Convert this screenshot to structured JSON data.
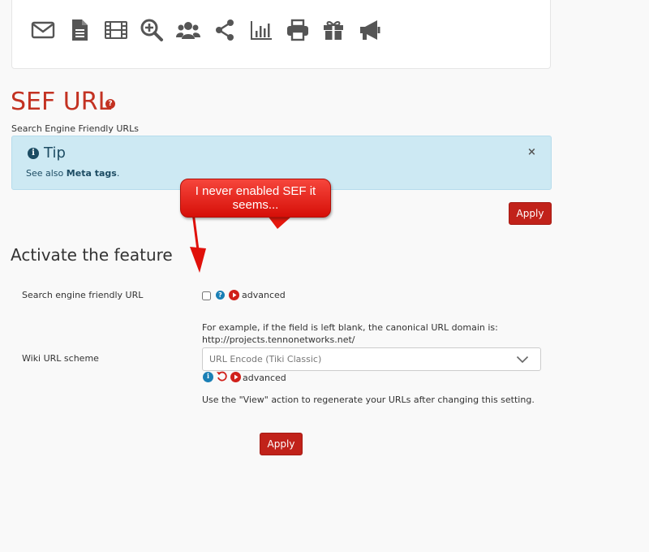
{
  "toolbar": {
    "icons": [
      "envelope-icon",
      "document-icon",
      "film-icon",
      "zoom-in-icon",
      "users-icon",
      "share-icon",
      "bar-chart-icon",
      "print-icon",
      "gift-icon",
      "megaphone-icon"
    ],
    "icon_color": "#555555"
  },
  "header": {
    "title": "SEF URL",
    "help_symbol": "?",
    "subtitle": "Search Engine Friendly URLs"
  },
  "tip": {
    "title": "Tip",
    "text_prefix": "See also ",
    "link": "Meta tags",
    "text_suffix": ".",
    "close_symbol": "×",
    "info_symbol": "i"
  },
  "callout": {
    "text": "I never enabled SEF it seems..."
  },
  "buttons": {
    "apply_top": "Apply",
    "apply_bottom": "Apply"
  },
  "section": {
    "heading": "Activate the feature",
    "sef_label": "Search engine friendly URL",
    "sef_advanced": "advanced",
    "scheme_label": "Wiki URL scheme",
    "scheme_help_line1": "For example, if the field is left blank, the canonical URL domain is:",
    "scheme_help_line2": "http://projects.tennonetworks.net/",
    "scheme_selected": "URL Encode (Tiki Classic)",
    "scheme_advanced": "advanced",
    "regenerate_note": "Use the \"View\" action to regenerate your URLs after changing this setting."
  },
  "colors": {
    "brand_red": "#c33222",
    "button_red": "#c1221a",
    "tip_bg": "#cde9f3",
    "tip_text": "#1d4c63",
    "info_blue": "#1a7fb5"
  }
}
